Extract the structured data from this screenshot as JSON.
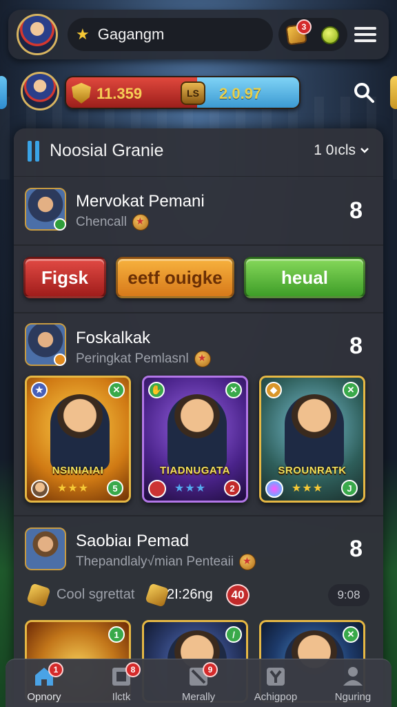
{
  "profile": {
    "name": "Gagangm"
  },
  "rewards": {
    "badge_count": "3"
  },
  "currency": {
    "gold": "11.359",
    "tier_badge": "LS",
    "gems": "2.0.97"
  },
  "panel": {
    "title": "Noosial Granie",
    "sort_label": "1 0ıcls"
  },
  "section1": {
    "title": "Mervokat Pemani",
    "subtitle": "Chencall",
    "count": "8"
  },
  "actions": {
    "red": "Figsk",
    "orange": "eetf ouigke",
    "green": "heual",
    "colors": {
      "red": "#c8302c",
      "orange": "#f0a030",
      "green": "#5cba3a"
    }
  },
  "section2": {
    "title": "Foskalkak",
    "subtitle": "Peringkat Pemlasnl",
    "count": "8",
    "cards": [
      {
        "name": "NSINIAIAI",
        "stars": "★★★",
        "corner_top": "✕",
        "corner_bottom": "5",
        "tier_color": "gold"
      },
      {
        "name": "TIADNUGATA",
        "stars": "★★★",
        "corner_top": "✕",
        "corner_bottom": "2",
        "tier_color": "purple"
      },
      {
        "name": "SROUNRATK",
        "stars": "★★★",
        "corner_top": "✕",
        "corner_bottom": "J",
        "tier_color": "gold"
      }
    ]
  },
  "section3": {
    "title": "Saobiaı Pemad",
    "subtitle": "Thepandlaly√mian Penteaii",
    "count": "8",
    "timer_label": "Cool sgrettat",
    "timer_value": "2I:26ng",
    "timer_badge": "40",
    "time_right": "9:08",
    "cards": [
      {
        "corner": "1"
      },
      {
        "corner": "/"
      },
      {
        "corner": "✕"
      }
    ]
  },
  "nav": [
    {
      "label": "Opnory",
      "icon": "home-icon",
      "badge": "1",
      "active": true
    },
    {
      "label": "Ilctk",
      "icon": "cards-icon",
      "badge": "8",
      "active": false
    },
    {
      "label": "Merally",
      "icon": "building-icon",
      "badge": "9",
      "active": false
    },
    {
      "label": "Achigpop",
      "icon": "y-shield-icon",
      "badge": "",
      "active": false
    },
    {
      "label": "Nguring",
      "icon": "person-icon",
      "badge": "",
      "active": false
    }
  ]
}
